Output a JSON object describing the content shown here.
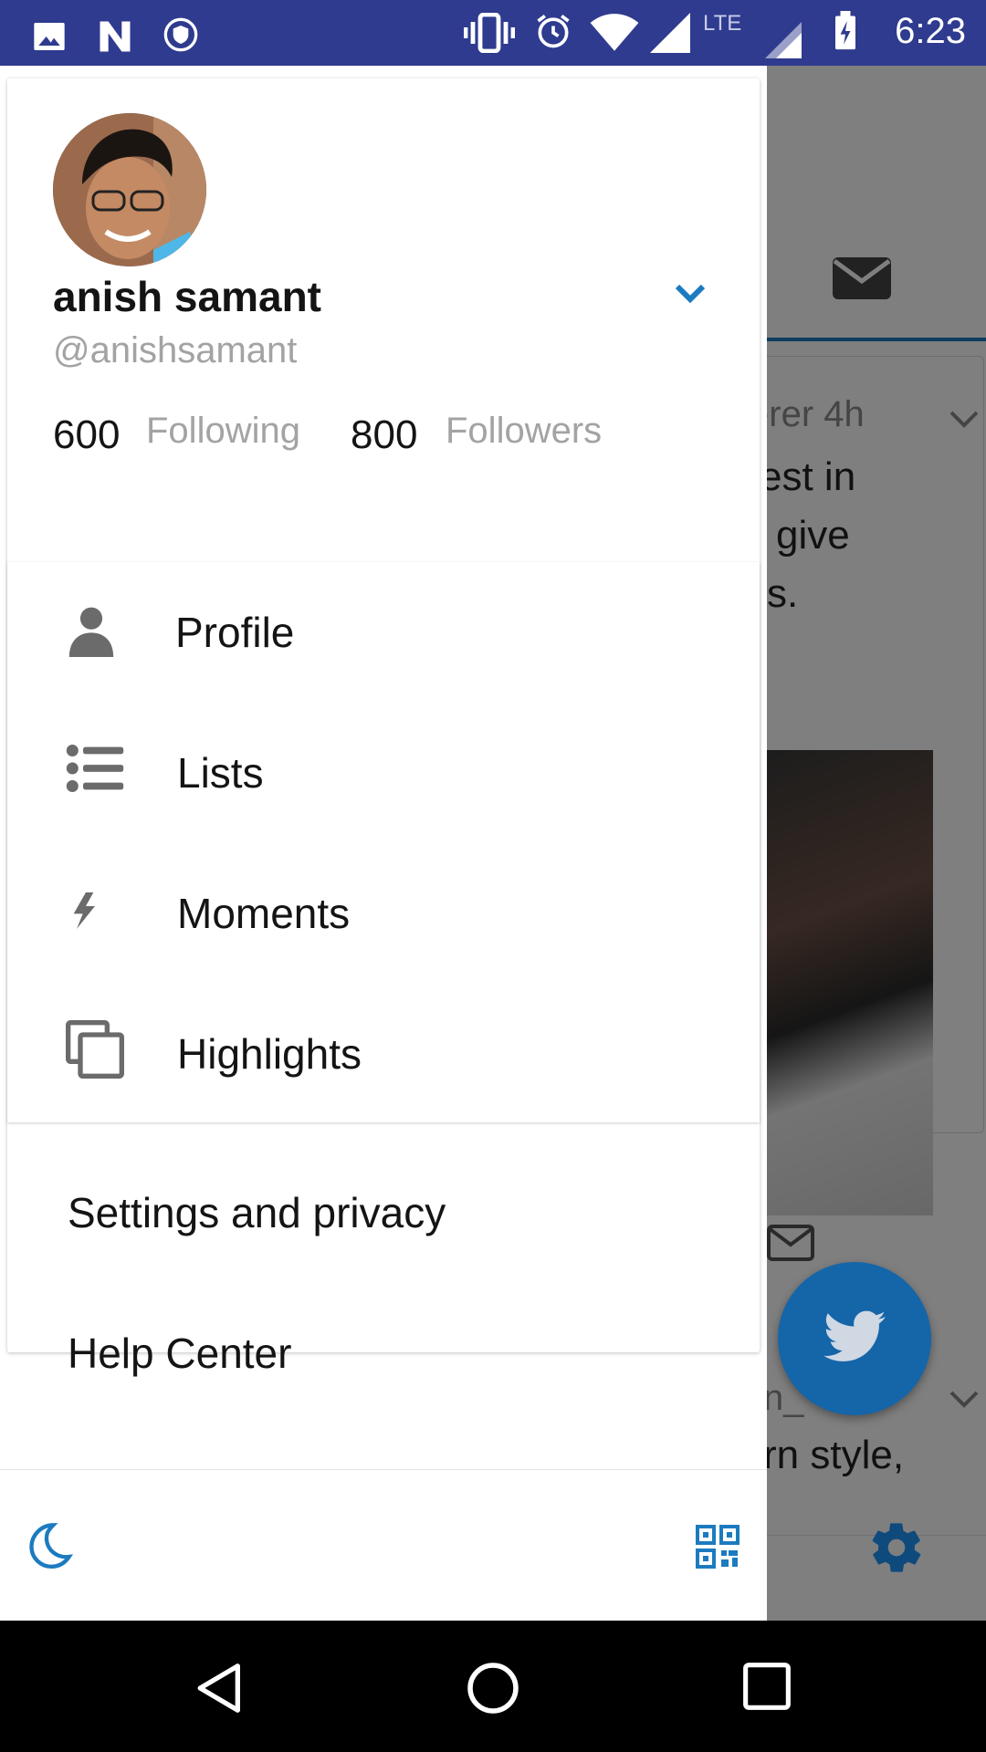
{
  "status_bar": {
    "time": "6:23",
    "network_label": "LTE",
    "icons": [
      "image-icon",
      "n-logo-icon",
      "vpn-shield-icon",
      "vibrate-icon",
      "alarm-icon",
      "wifi-icon",
      "cell-signal-icon",
      "battery-charging-icon"
    ],
    "background": "#2f3b8f"
  },
  "background_app": {
    "tweet_meta": "erer  4h",
    "tweet_lines": [
      "est in",
      "give",
      "s."
    ],
    "next_tweet_meta": "n_",
    "next_tweet_text": "rn style,"
  },
  "profile": {
    "name": "anish samant",
    "handle": "@anishsamant",
    "following_count": "600",
    "following_label": "Following",
    "followers_count": "800",
    "followers_label": "Followers"
  },
  "menu": {
    "items": [
      {
        "label": "Profile",
        "icon": "person-icon"
      },
      {
        "label": "Lists",
        "icon": "list-icon"
      },
      {
        "label": "Moments",
        "icon": "lightning-icon"
      },
      {
        "label": "Highlights",
        "icon": "copy-icon"
      }
    ],
    "settings_label": "Settings and privacy",
    "help_label": "Help Center"
  },
  "colors": {
    "accent": "#1c7bc0",
    "fab": "#1565a9",
    "text_primary": "#141414",
    "text_secondary": "#a3a3a3",
    "icon_gray": "#6b6b6b"
  }
}
